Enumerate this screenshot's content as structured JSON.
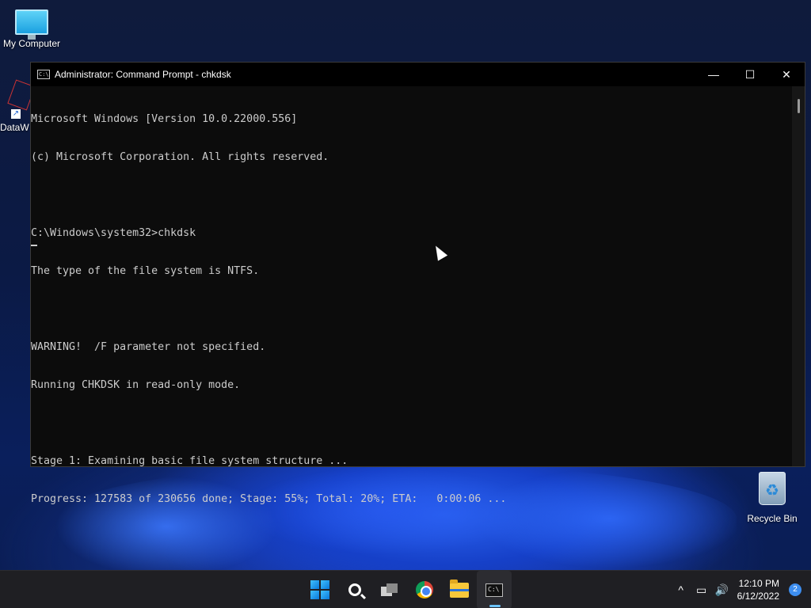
{
  "desktop": {
    "icons": [
      {
        "label": "My Computer"
      },
      {
        "label": "DataW"
      },
      {
        "label": "Recycle Bin"
      }
    ]
  },
  "window": {
    "title": "Administrator: Command Prompt - chkdsk",
    "title_icon_text": "C:\\",
    "controls": {
      "minimize": "—",
      "maximize": "☐",
      "close": "✕"
    },
    "console_lines": [
      "Microsoft Windows [Version 10.0.22000.556]",
      "(c) Microsoft Corporation. All rights reserved.",
      "",
      "C:\\Windows\\system32>chkdsk",
      "The type of the file system is NTFS.",
      "",
      "WARNING!  /F parameter not specified.",
      "Running CHKDSK in read-only mode.",
      "",
      "Stage 1: Examining basic file system structure ...",
      "Progress: 127583 of 230656 done; Stage: 55%; Total: 20%; ETA:   0:00:06 ..."
    ]
  },
  "taskbar": {
    "apps": [
      {
        "name": "start-icon"
      },
      {
        "name": "search-icon"
      },
      {
        "name": "task-view-icon"
      },
      {
        "name": "chrome-icon"
      },
      {
        "name": "file-explorer-icon"
      },
      {
        "name": "command-prompt-icon"
      }
    ],
    "tray": {
      "chevron": "^",
      "network_icon": "▭",
      "volume_icon": "🔊",
      "time": "12:10 PM",
      "date": "6/12/2022",
      "notification_count": "2"
    }
  }
}
